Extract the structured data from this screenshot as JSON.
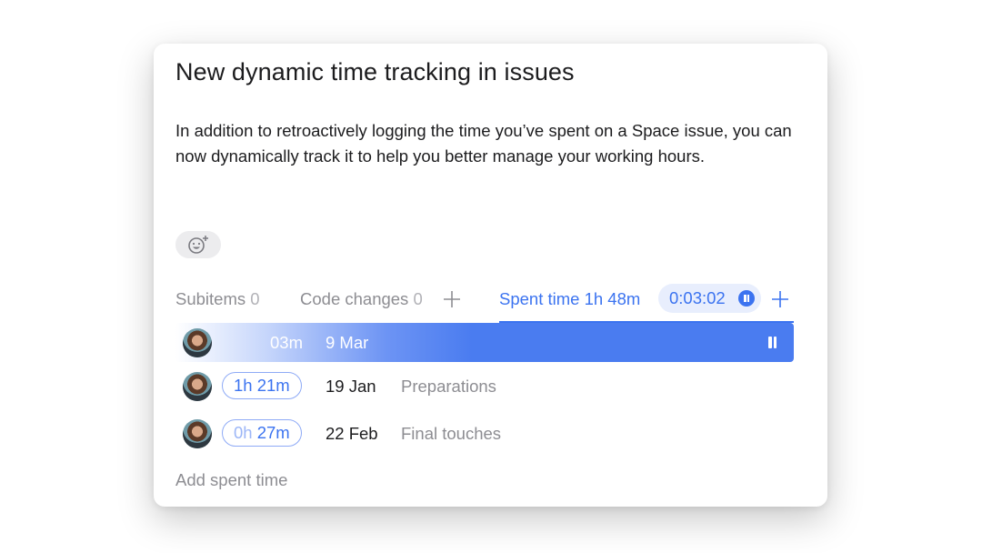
{
  "card": {
    "title": "New dynamic time tracking in issues",
    "description": "In addition to retroactively logging the time you’ve spent on a Space issue, you can now dynamically track it to help you better manage your working hours."
  },
  "reaction_button": {
    "icon": "add-emoji-icon"
  },
  "tabs": {
    "subitems": {
      "label": "Subitems",
      "count": "0"
    },
    "code_changes": {
      "label": "Code changes",
      "count": "0",
      "icon": "plus-icon"
    },
    "spent_time": {
      "label": "Spent time",
      "count": "1h 48m",
      "timer": "0:03:02",
      "timer_icon": "pause-icon",
      "add_icon": "plus-icon"
    }
  },
  "entries": {
    "active": {
      "duration": "03m",
      "date": "9 Mar",
      "icon": "pause-icon"
    },
    "items": [
      {
        "hours": "1h",
        "minutes": "21m",
        "date": "19 Jan",
        "note": "Preparations"
      },
      {
        "hours": "0h",
        "minutes": "27m",
        "date": "22 Feb",
        "note": "Final touches"
      }
    ]
  },
  "add_spent_time_label": "Add spent time",
  "colors": {
    "accent": "#3b73f0",
    "accent_light": "#e8eefd",
    "muted_text": "#8d8d92",
    "text": "#1c1c1e"
  }
}
